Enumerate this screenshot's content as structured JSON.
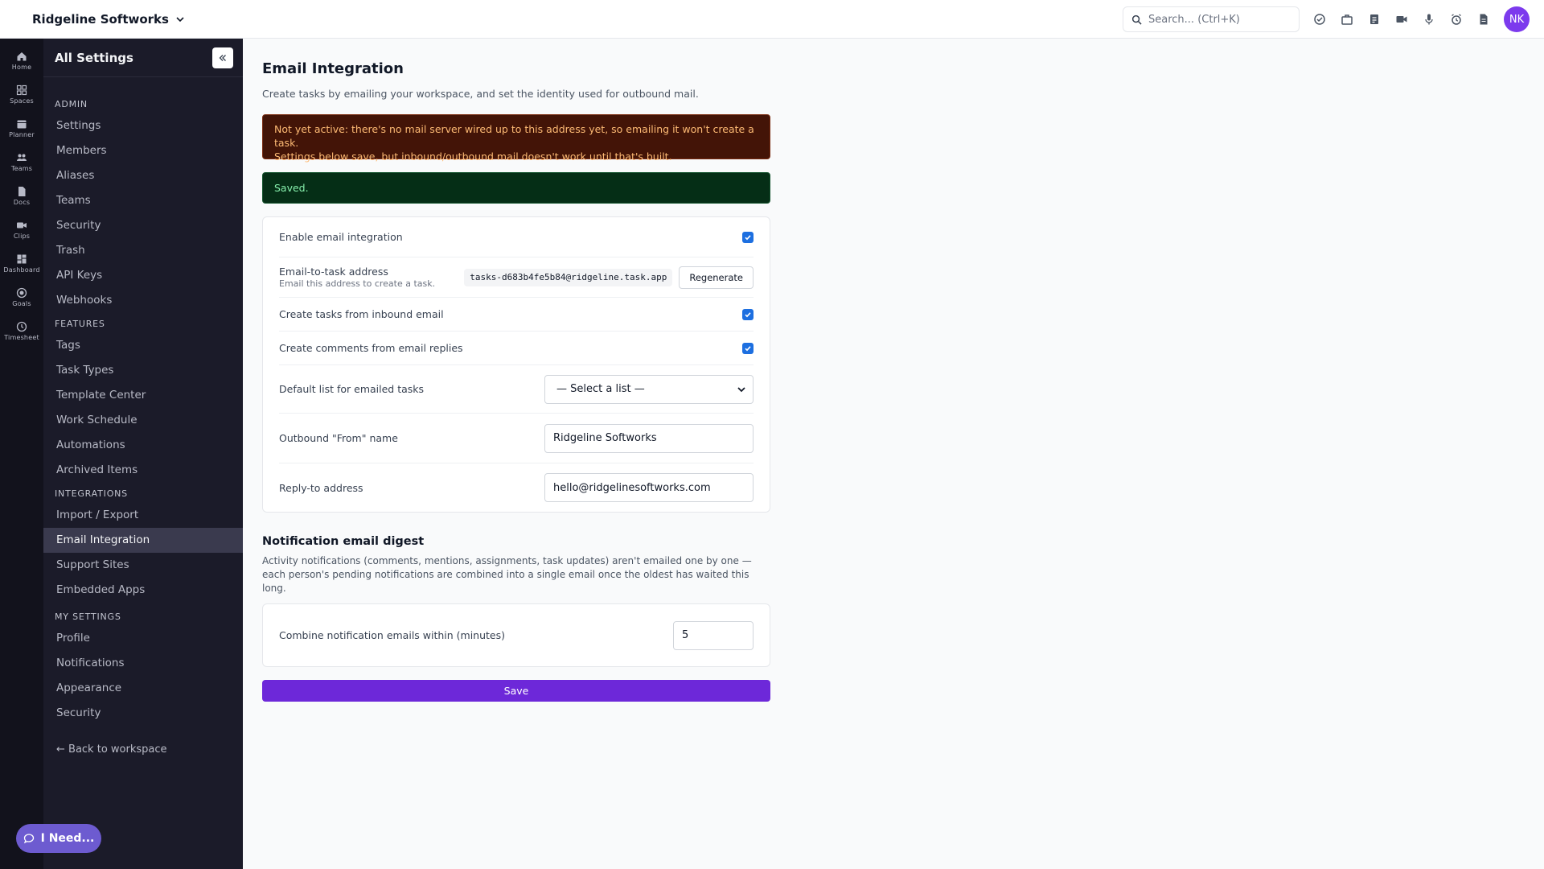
{
  "workspace": {
    "name": "Ridgeline Softworks"
  },
  "topbar": {
    "search_placeholder": "Search... (Ctrl+K)",
    "avatar_initials": "NK",
    "icons": [
      "check-circle-icon",
      "briefcase-icon",
      "clipboard-icon",
      "video-icon",
      "microphone-icon",
      "alarm-icon",
      "document-icon"
    ]
  },
  "rail": {
    "items": [
      {
        "label": "Home",
        "icon": "home-icon"
      },
      {
        "label": "Spaces",
        "icon": "grid-icon"
      },
      {
        "label": "Planner",
        "icon": "calendar-icon"
      },
      {
        "label": "Teams",
        "icon": "users-icon"
      },
      {
        "label": "Docs",
        "icon": "doc-icon"
      },
      {
        "label": "Clips",
        "icon": "video-icon"
      },
      {
        "label": "Dashboard",
        "icon": "dashboard-icon"
      },
      {
        "label": "Goals",
        "icon": "target-icon"
      },
      {
        "label": "Timesheet",
        "icon": "clock-icon"
      }
    ]
  },
  "sidebar": {
    "title": "All Settings",
    "sections": [
      {
        "heading": "ADMIN",
        "items": [
          "Settings",
          "Members",
          "Aliases",
          "Teams",
          "Security",
          "Trash",
          "API Keys",
          "Webhooks"
        ]
      },
      {
        "heading": "FEATURES",
        "items": [
          "Tags",
          "Task Types",
          "Template Center",
          "Work Schedule",
          "Automations",
          "Archived Items"
        ]
      },
      {
        "heading": "INTEGRATIONS",
        "items": [
          "Import / Export",
          "Email Integration",
          "Support Sites",
          "Embedded Apps"
        ]
      },
      {
        "heading": "MY SETTINGS",
        "items": [
          "Profile",
          "Notifications",
          "Appearance",
          "Security"
        ]
      }
    ],
    "active_item": "Email Integration",
    "back_label": "← Back to workspace"
  },
  "help_button": {
    "label": "I Need..."
  },
  "page": {
    "title": "Email Integration",
    "subtitle": "Create tasks by emailing your workspace, and set the identity used for outbound mail.",
    "warning_line1": "Not yet active: there's no mail server wired up to this address yet, so emailing it won't create a task.",
    "warning_line2": "Settings below save, but inbound/outbound mail doesn't work until that's built.",
    "saved_message": "Saved.",
    "settings": {
      "enable_label": "Enable email integration",
      "enable_checked": true,
      "address_label": "Email-to-task address",
      "address_hint": "Email this address to create a task.",
      "address_value": "tasks-d683b4fe5b84@ridgeline.task.app",
      "regenerate_label": "Regenerate",
      "inbound_label": "Create tasks from inbound email",
      "inbound_checked": true,
      "replies_label": "Create comments from email replies",
      "replies_checked": true,
      "default_list_label": "Default list for emailed tasks",
      "default_list_value": "— Select a list —",
      "from_name_label": "Outbound \"From\" name",
      "from_name_value": "Ridgeline Softworks",
      "reply_to_label": "Reply-to address",
      "reply_to_value": "hello@ridgelinesoftworks.com"
    },
    "digest": {
      "title": "Notification email digest",
      "description": "Activity notifications (comments, mentions, assignments, task updates) aren't emailed one by one — each person's pending notifications are combined into a single email once the oldest has waited this long.",
      "combine_label": "Combine notification emails within (minutes)",
      "combine_value": "5"
    },
    "save_label": "Save"
  },
  "colors": {
    "accent": "#6d28d9",
    "checkbox": "#1d6fe0",
    "warning_bg": "#431407",
    "success_bg": "#052e16"
  }
}
